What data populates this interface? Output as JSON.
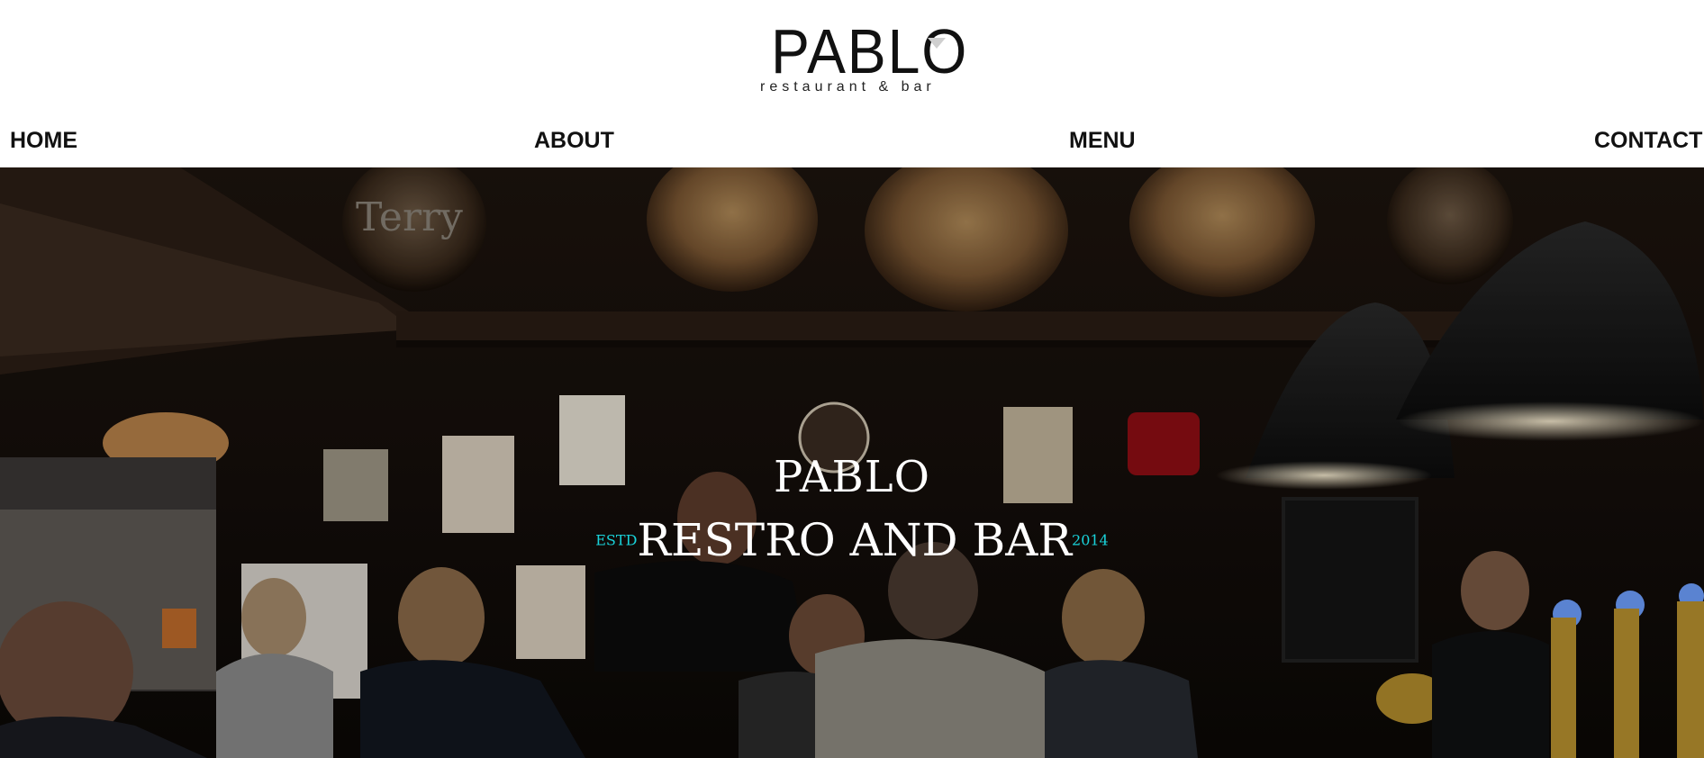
{
  "brand": {
    "logo_word": "PABLO",
    "logo_sub": "restaurant & bar"
  },
  "nav": {
    "items": [
      {
        "label": "HOME"
      },
      {
        "label": "ABOUT"
      },
      {
        "label": "MENU"
      },
      {
        "label": "CONTACT"
      }
    ]
  },
  "hero": {
    "title": "PABLO",
    "prefix": "ESTD",
    "subtitle": "RESTRO AND BAR",
    "year": "2014",
    "accent_color": "#19d3da",
    "image_description_icon": "bar-interior-photo"
  }
}
